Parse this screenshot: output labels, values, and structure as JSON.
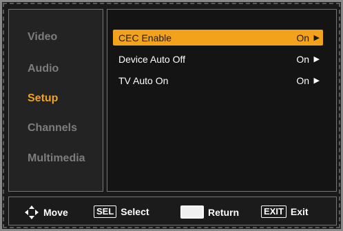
{
  "sidebar": {
    "items": [
      {
        "label": "Video"
      },
      {
        "label": "Audio"
      },
      {
        "label": "Setup"
      },
      {
        "label": "Channels"
      },
      {
        "label": "Multimedia"
      }
    ],
    "active_index": 2
  },
  "content": {
    "rows": [
      {
        "label": "CEC Enable",
        "value": "On"
      },
      {
        "label": "Device Auto Off",
        "value": "On"
      },
      {
        "label": "TV Auto On",
        "value": "On"
      }
    ],
    "arrow_glyph": "▶"
  },
  "footer": {
    "move": {
      "icon": "directional-pad-icon",
      "label": "Move"
    },
    "select": {
      "key": "SEL",
      "label": "Select"
    },
    "return": {
      "icon": "return-key-icon",
      "label": "Return"
    },
    "exit": {
      "key": "EXIT",
      "label": "Exit"
    }
  },
  "colors": {
    "accent": "#f2a31b",
    "inactive_text": "#7d7d7d",
    "background": "#1a1a1a"
  }
}
